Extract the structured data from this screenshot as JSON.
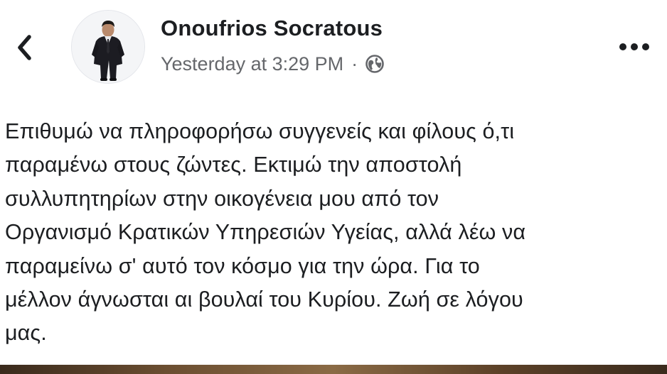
{
  "header": {
    "back_icon": "chevron-left-icon",
    "avatar_icon": "profile-photo-man-in-suit",
    "author_name": "Onoufrios Socratous",
    "timestamp": "Yesterday at 3:29 PM",
    "separator": "·",
    "privacy_icon": "globe-icon",
    "more_icon": "more-horizontal-icon"
  },
  "post": {
    "text": "Επιθυμώ να πληροφορήσω συγγενείς και φίλους ό,τι\nπαραμένω στους ζώντες. Εκτιμώ την αποστολή\nσυλλυπητηρίων στην οικογένεια μου από τον\nΟργανισμό Κρατικών Υπηρεσιών Υγείας, αλλά λέω να\nπαραμείνω σ' αυτό τον κόσμο για την ώρα. Για το\nμέλλον άγνωσται αι βουλαί του Κυρίου. Ζωή σε λόγου\nμας."
  },
  "colors": {
    "text_primary": "#1c1e21",
    "text_secondary": "#65676b",
    "background": "#ffffff"
  }
}
